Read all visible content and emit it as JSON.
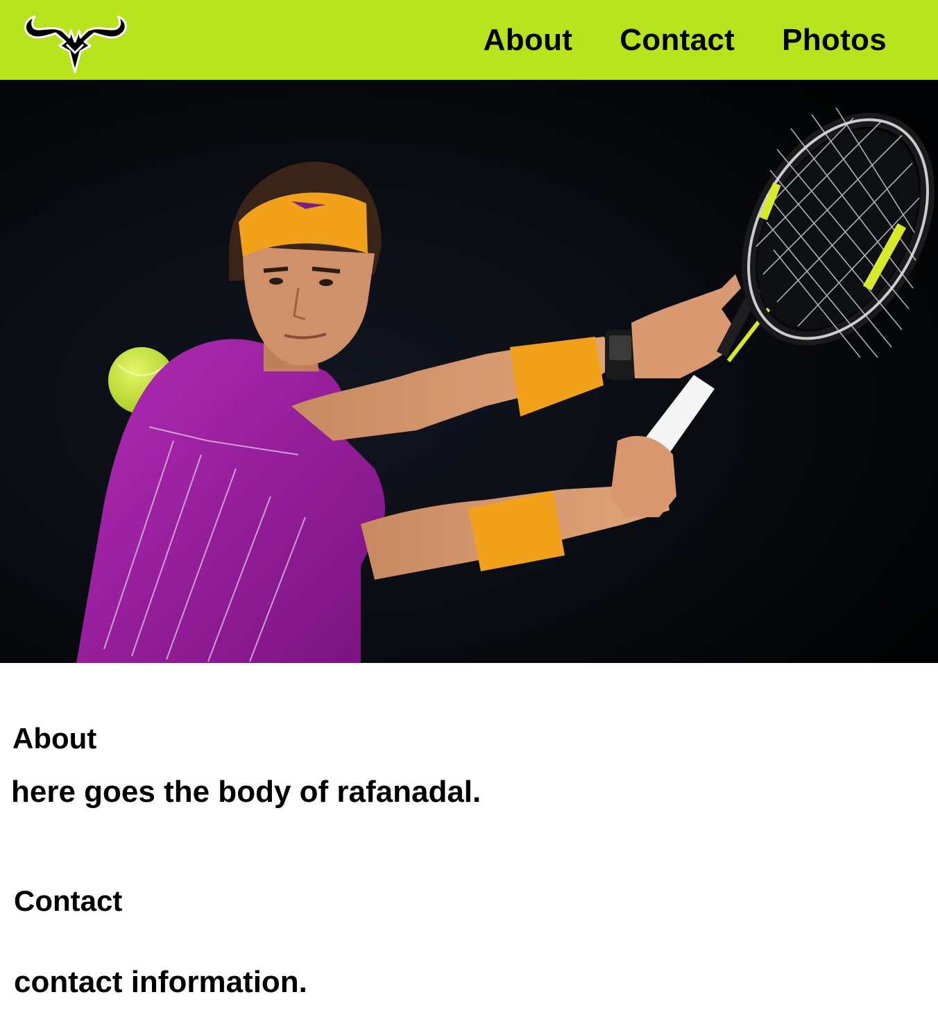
{
  "header": {
    "logo": {
      "icon": "bull-horns-logo-icon"
    },
    "nav": [
      {
        "label": "About"
      },
      {
        "label": "Contact"
      },
      {
        "label": "Photos"
      }
    ],
    "accent_color": "#b8e41f"
  },
  "hero": {
    "subject": "tennis-player-backhand-photo",
    "colors": {
      "background": "#050608",
      "shirt": "#9b1fa0",
      "headband": "#f2a21a",
      "ball": "#c7e833"
    }
  },
  "sections": {
    "about": {
      "title": "About",
      "body": "here goes the body of rafanadal."
    },
    "contact": {
      "title": "Contact",
      "body": "contact information."
    }
  }
}
